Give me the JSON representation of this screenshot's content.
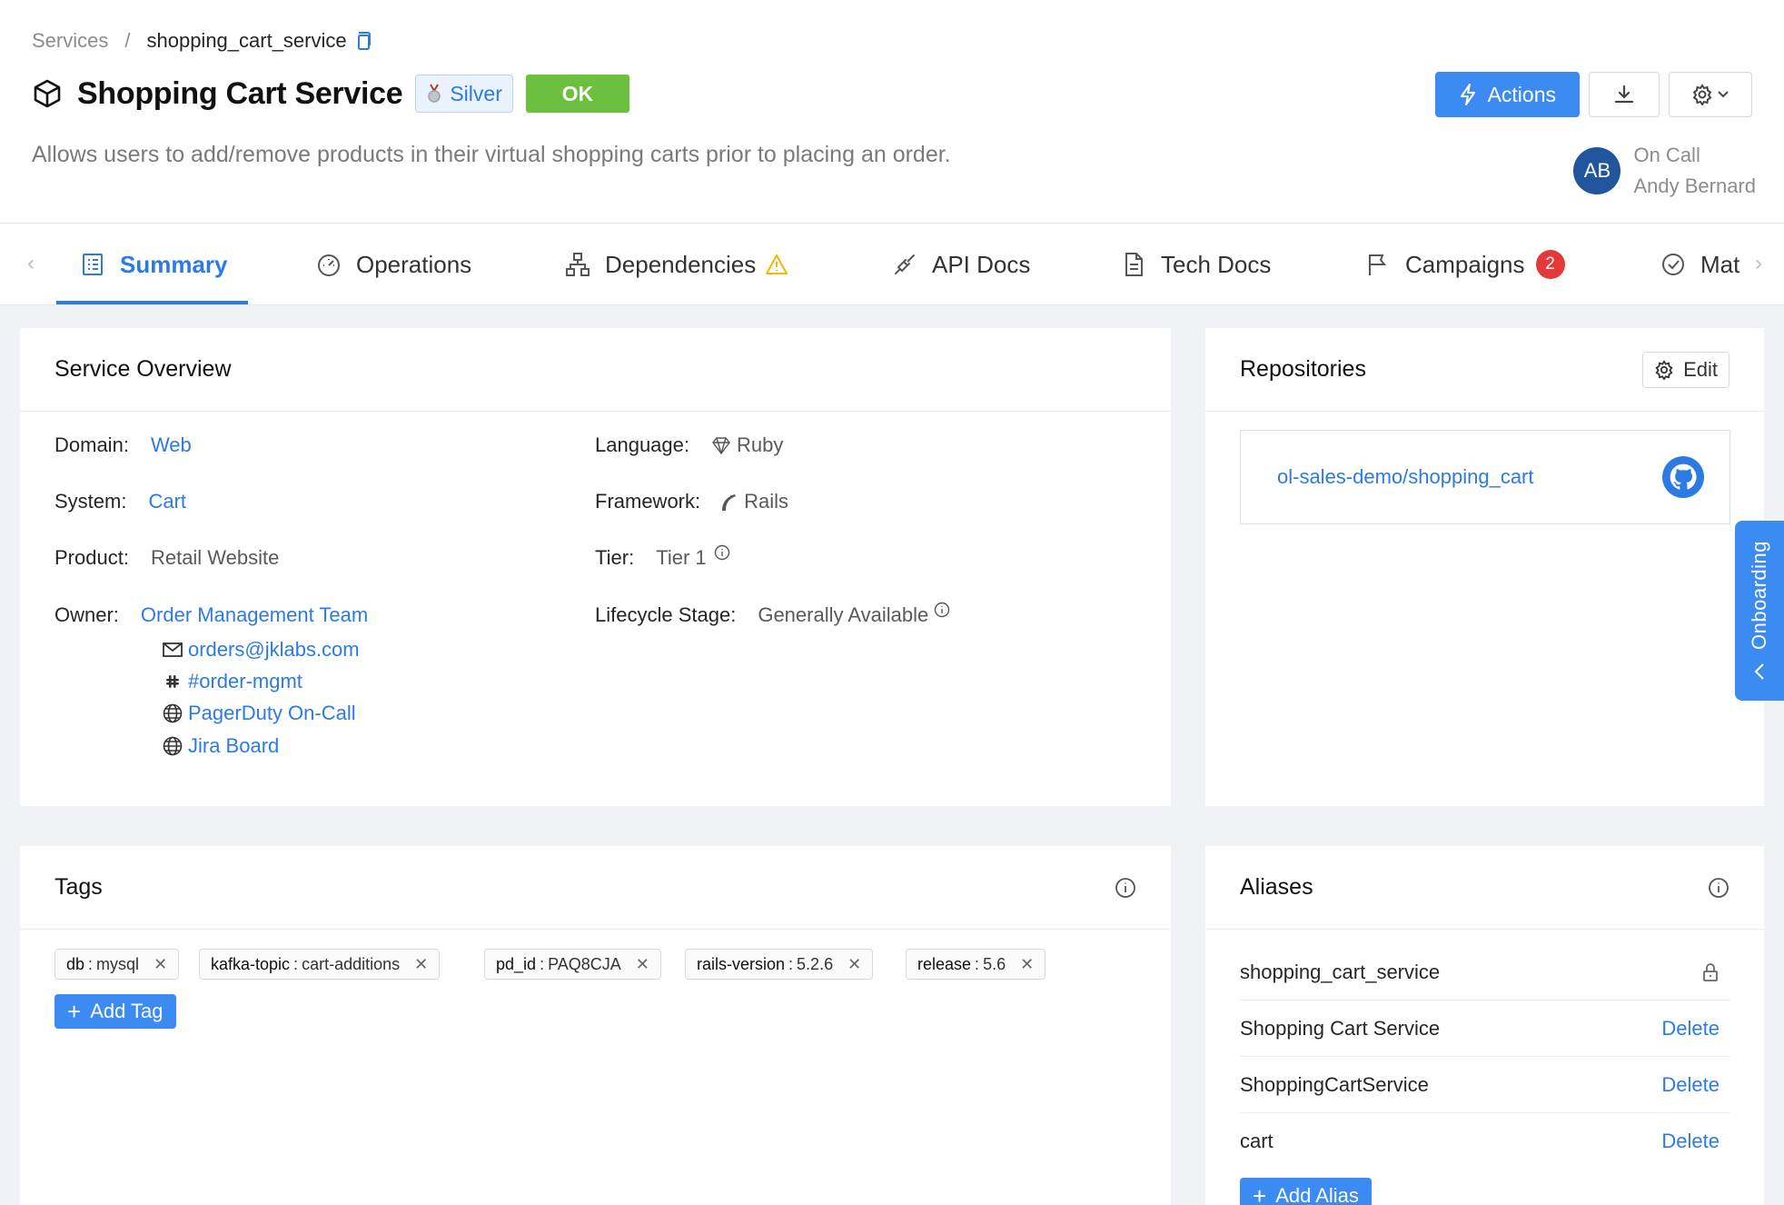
{
  "breadcrumb": {
    "root": "Services",
    "separator": "/",
    "current": "shopping_cart_service"
  },
  "service": {
    "title": "Shopping Cart Service",
    "level_badge": "Silver",
    "status_badge": "OK",
    "description": "Allows users to add/remove products in their virtual shopping carts prior to placing an order."
  },
  "header_actions": {
    "actions_label": "Actions"
  },
  "oncall": {
    "initials": "AB",
    "label": "On Call",
    "name": "Andy Bernard"
  },
  "tabs": [
    {
      "label": "Summary",
      "icon": "summary-icon",
      "active": true
    },
    {
      "label": "Operations",
      "icon": "gauge-icon"
    },
    {
      "label": "Dependencies",
      "icon": "hierarchy-icon"
    },
    {
      "label": "API Docs",
      "icon": "api-icon"
    },
    {
      "label": "Tech Docs",
      "icon": "document-icon"
    },
    {
      "label": "Campaigns",
      "icon": "flag-icon",
      "count": "2"
    },
    {
      "label": "Mat",
      "icon": "check-circle-icon"
    }
  ],
  "overview": {
    "title": "Service Overview",
    "domain_label": "Domain",
    "domain_value": "Web",
    "system_label": "System",
    "system_value": "Cart",
    "product_label": "Product",
    "product_value": "Retail Website",
    "owner_label": "Owner",
    "owner_value": "Order Management Team",
    "contacts": {
      "email": "orders@jklabs.com",
      "slack": "#order-mgmt",
      "pagerduty": "PagerDuty On-Call",
      "jira": "Jira Board"
    },
    "language_label": "Language",
    "language_value": "Ruby",
    "framework_label": "Framework",
    "framework_value": "Rails",
    "tier_label": "Tier",
    "tier_value": "Tier 1",
    "lifecycle_label": "Lifecycle Stage",
    "lifecycle_value": "Generally Available"
  },
  "repositories": {
    "title": "Repositories",
    "edit_label": "Edit",
    "repo_name": "ol-sales-demo/shopping_cart"
  },
  "tags": {
    "title": "Tags",
    "items": [
      {
        "key": "db",
        "value": "mysql"
      },
      {
        "key": "kafka-topic",
        "value": "cart-additions"
      },
      {
        "key": "pd_id",
        "value": "PAQ8CJA"
      },
      {
        "key": "rails-version",
        "value": "5.2.6"
      },
      {
        "key": "release",
        "value": "5.6"
      }
    ],
    "add_label": "Add Tag"
  },
  "aliases": {
    "title": "Aliases",
    "items": [
      {
        "name": "shopping_cart_service",
        "locked": true
      },
      {
        "name": "Shopping Cart Service",
        "action": "Delete"
      },
      {
        "name": "ShoppingCartService",
        "action": "Delete"
      },
      {
        "name": "cart",
        "action": "Delete"
      }
    ],
    "add_label": "Add Alias"
  },
  "onboarding": {
    "label": "Onboarding"
  },
  "colors": {
    "accent": "#2c7be5",
    "primary_button": "#3b8bf2",
    "ok_green": "#6bc03f",
    "badge_red": "#e23a3a",
    "avatar_blue": "#21559e"
  }
}
